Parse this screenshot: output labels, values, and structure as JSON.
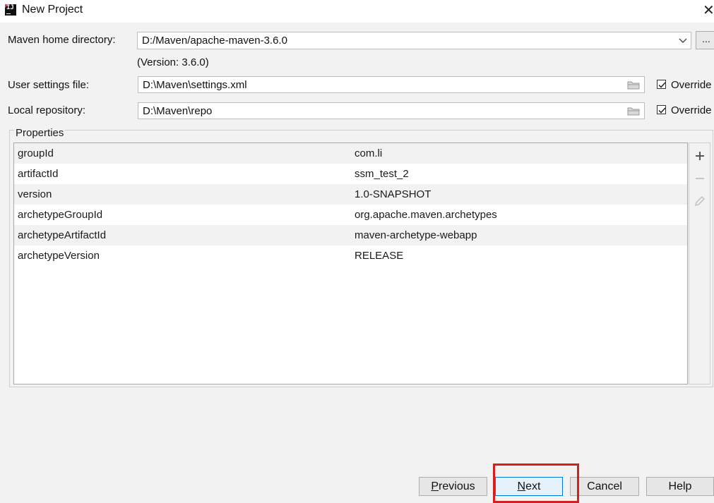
{
  "window": {
    "title": "New Project"
  },
  "form": {
    "maven_home_label": "Maven home directory:",
    "maven_home_value": "D:/Maven/apache-maven-3.6.0",
    "browse_label": "...",
    "version_note": "(Version: 3.6.0)",
    "user_settings_label": "User settings file:",
    "user_settings_value": "D:\\Maven\\settings.xml",
    "user_settings_override": "Override",
    "local_repo_label": "Local repository:",
    "local_repo_value": "D:\\Maven\\repo",
    "local_repo_override": "Override"
  },
  "properties": {
    "title": "Properties",
    "rows": [
      {
        "name": "groupId",
        "value": "com.li"
      },
      {
        "name": "artifactId",
        "value": "ssm_test_2"
      },
      {
        "name": "version",
        "value": "1.0-SNAPSHOT"
      },
      {
        "name": "archetypeGroupId",
        "value": "org.apache.maven.archetypes"
      },
      {
        "name": "archetypeArtifactId",
        "value": "maven-archetype-webapp"
      },
      {
        "name": "archetypeVersion",
        "value": "RELEASE"
      }
    ]
  },
  "buttons": {
    "previous": {
      "first": "P",
      "rest": "revious"
    },
    "next": {
      "first": "N",
      "rest": "ext"
    },
    "cancel": "Cancel",
    "help": "Help"
  },
  "colors": {
    "highlight": "#d4211e",
    "primary_border": "#0078d7"
  },
  "icons": [
    "intellij-icon",
    "close-icon",
    "chevron-down-icon",
    "folder-icon",
    "checkbox-checked-icon",
    "plus-icon",
    "minus-icon",
    "pencil-icon"
  ]
}
